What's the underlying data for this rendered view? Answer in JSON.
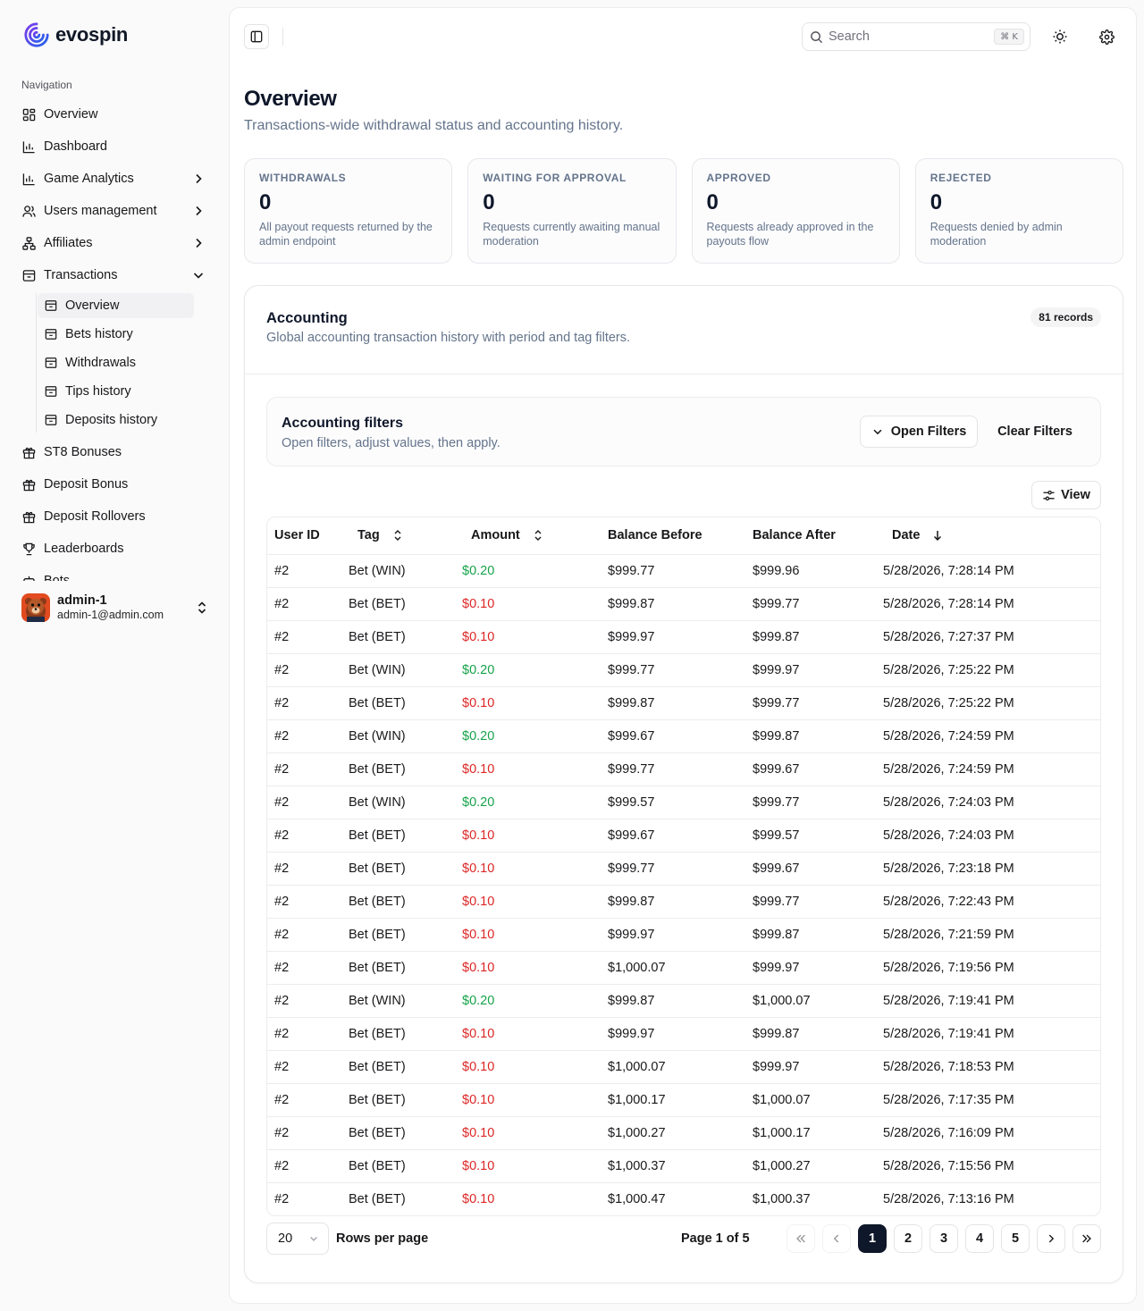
{
  "brand": {
    "name": "evospin"
  },
  "sidebar": {
    "section_label": "Navigation",
    "items": [
      {
        "label": "Overview",
        "icon": "layout-grid-icon"
      },
      {
        "label": "Dashboard",
        "icon": "bar-chart-icon"
      },
      {
        "label": "Game Analytics",
        "icon": "bar-chart-icon",
        "expandable": true
      },
      {
        "label": "Users management",
        "icon": "users-icon",
        "expandable": true
      },
      {
        "label": "Affiliates",
        "icon": "network-icon",
        "expandable": true
      },
      {
        "label": "Transactions",
        "icon": "archive-icon",
        "expanded": true
      }
    ],
    "transactions_sub": [
      {
        "label": "Overview",
        "active": true
      },
      {
        "label": "Bets history"
      },
      {
        "label": "Withdrawals"
      },
      {
        "label": "Tips history"
      },
      {
        "label": "Deposits history"
      }
    ],
    "items_after": [
      {
        "label": "ST8 Bonuses",
        "icon": "gift-icon"
      },
      {
        "label": "Deposit Bonus",
        "icon": "gift-icon"
      },
      {
        "label": "Deposit Rollovers",
        "icon": "gift-icon"
      },
      {
        "label": "Leaderboards",
        "icon": "trophy-icon"
      },
      {
        "label": "Bots",
        "icon": "bot-icon"
      }
    ],
    "user": {
      "name": "admin-1",
      "email": "admin-1@admin.com"
    }
  },
  "topbar": {
    "search_placeholder": "Search",
    "shortcut": "⌘ K"
  },
  "page": {
    "title": "Overview",
    "subtitle": "Transactions-wide withdrawal status and accounting history."
  },
  "cards": [
    {
      "label": "WITHDRAWALS",
      "value": "0",
      "desc": "All payout requests returned by the admin endpoint"
    },
    {
      "label": "WAITING FOR APPROVAL",
      "value": "0",
      "desc": "Requests currently awaiting manual moderation"
    },
    {
      "label": "APPROVED",
      "value": "0",
      "desc": "Requests already approved in the payouts flow"
    },
    {
      "label": "REJECTED",
      "value": "0",
      "desc": "Requests denied by admin moderation"
    }
  ],
  "accounting": {
    "title": "Accounting",
    "subtitle": "Global accounting transaction history with period and tag filters.",
    "records_badge": "81 records",
    "filters": {
      "title": "Accounting filters",
      "subtitle": "Open filters, adjust values, then apply.",
      "open_label": "Open Filters",
      "clear_label": "Clear Filters"
    },
    "view_label": "View",
    "columns": [
      "User ID",
      "Tag",
      "Amount",
      "Balance Before",
      "Balance After",
      "Date"
    ],
    "rows": [
      {
        "user": "#2",
        "tag": "Bet (WIN)",
        "amount": "$0.20",
        "type": "pos",
        "before": "$999.77",
        "after": "$999.96",
        "date": "5/28/2026, 7:28:14 PM"
      },
      {
        "user": "#2",
        "tag": "Bet (BET)",
        "amount": "$0.10",
        "type": "neg",
        "before": "$999.87",
        "after": "$999.77",
        "date": "5/28/2026, 7:28:14 PM"
      },
      {
        "user": "#2",
        "tag": "Bet (BET)",
        "amount": "$0.10",
        "type": "neg",
        "before": "$999.97",
        "after": "$999.87",
        "date": "5/28/2026, 7:27:37 PM"
      },
      {
        "user": "#2",
        "tag": "Bet (WIN)",
        "amount": "$0.20",
        "type": "pos",
        "before": "$999.77",
        "after": "$999.97",
        "date": "5/28/2026, 7:25:22 PM"
      },
      {
        "user": "#2",
        "tag": "Bet (BET)",
        "amount": "$0.10",
        "type": "neg",
        "before": "$999.87",
        "after": "$999.77",
        "date": "5/28/2026, 7:25:22 PM"
      },
      {
        "user": "#2",
        "tag": "Bet (WIN)",
        "amount": "$0.20",
        "type": "pos",
        "before": "$999.67",
        "after": "$999.87",
        "date": "5/28/2026, 7:24:59 PM"
      },
      {
        "user": "#2",
        "tag": "Bet (BET)",
        "amount": "$0.10",
        "type": "neg",
        "before": "$999.77",
        "after": "$999.67",
        "date": "5/28/2026, 7:24:59 PM"
      },
      {
        "user": "#2",
        "tag": "Bet (WIN)",
        "amount": "$0.20",
        "type": "pos",
        "before": "$999.57",
        "after": "$999.77",
        "date": "5/28/2026, 7:24:03 PM"
      },
      {
        "user": "#2",
        "tag": "Bet (BET)",
        "amount": "$0.10",
        "type": "neg",
        "before": "$999.67",
        "after": "$999.57",
        "date": "5/28/2026, 7:24:03 PM"
      },
      {
        "user": "#2",
        "tag": "Bet (BET)",
        "amount": "$0.10",
        "type": "neg",
        "before": "$999.77",
        "after": "$999.67",
        "date": "5/28/2026, 7:23:18 PM"
      },
      {
        "user": "#2",
        "tag": "Bet (BET)",
        "amount": "$0.10",
        "type": "neg",
        "before": "$999.87",
        "after": "$999.77",
        "date": "5/28/2026, 7:22:43 PM"
      },
      {
        "user": "#2",
        "tag": "Bet (BET)",
        "amount": "$0.10",
        "type": "neg",
        "before": "$999.97",
        "after": "$999.87",
        "date": "5/28/2026, 7:21:59 PM"
      },
      {
        "user": "#2",
        "tag": "Bet (BET)",
        "amount": "$0.10",
        "type": "neg",
        "before": "$1,000.07",
        "after": "$999.97",
        "date": "5/28/2026, 7:19:56 PM"
      },
      {
        "user": "#2",
        "tag": "Bet (WIN)",
        "amount": "$0.20",
        "type": "pos",
        "before": "$999.87",
        "after": "$1,000.07",
        "date": "5/28/2026, 7:19:41 PM"
      },
      {
        "user": "#2",
        "tag": "Bet (BET)",
        "amount": "$0.10",
        "type": "neg",
        "before": "$999.97",
        "after": "$999.87",
        "date": "5/28/2026, 7:19:41 PM"
      },
      {
        "user": "#2",
        "tag": "Bet (BET)",
        "amount": "$0.10",
        "type": "neg",
        "before": "$1,000.07",
        "after": "$999.97",
        "date": "5/28/2026, 7:18:53 PM"
      },
      {
        "user": "#2",
        "tag": "Bet (BET)",
        "amount": "$0.10",
        "type": "neg",
        "before": "$1,000.17",
        "after": "$1,000.07",
        "date": "5/28/2026, 7:17:35 PM"
      },
      {
        "user": "#2",
        "tag": "Bet (BET)",
        "amount": "$0.10",
        "type": "neg",
        "before": "$1,000.27",
        "after": "$1,000.17",
        "date": "5/28/2026, 7:16:09 PM"
      },
      {
        "user": "#2",
        "tag": "Bet (BET)",
        "amount": "$0.10",
        "type": "neg",
        "before": "$1,000.37",
        "after": "$1,000.27",
        "date": "5/28/2026, 7:15:56 PM"
      },
      {
        "user": "#2",
        "tag": "Bet (BET)",
        "amount": "$0.10",
        "type": "neg",
        "before": "$1,000.47",
        "after": "$1,000.37",
        "date": "5/28/2026, 7:13:16 PM"
      }
    ],
    "pagination": {
      "rows_per_page": "20",
      "rows_label": "Rows per page",
      "page_info": "Page 1 of 5",
      "pages": [
        "1",
        "2",
        "3",
        "4",
        "5"
      ],
      "current": "1"
    }
  },
  "colors": {
    "positive": "#16a34a",
    "negative": "#dc2626",
    "brand": "#4f46e5",
    "active_page": "#0f172a"
  }
}
